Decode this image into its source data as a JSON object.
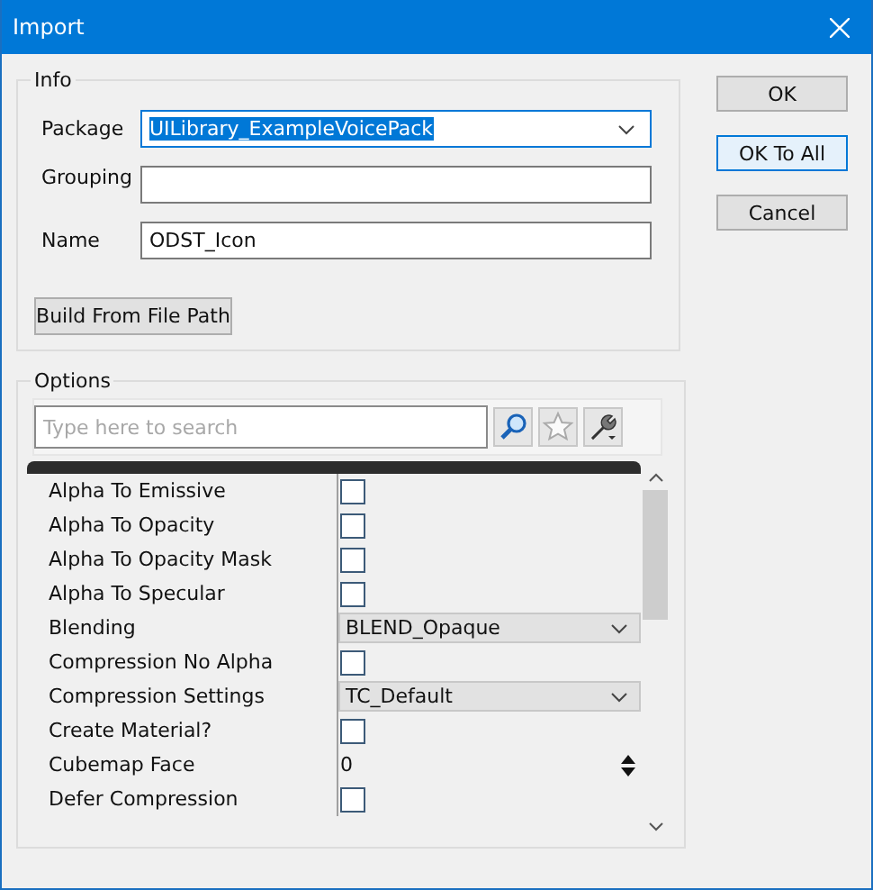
{
  "window": {
    "title": "Import"
  },
  "buttons": [
    {
      "label": "OK",
      "focused": false
    },
    {
      "label": "OK To All",
      "focused": true
    },
    {
      "label": "Cancel",
      "focused": false
    }
  ],
  "info": {
    "title": "Info",
    "fields": [
      {
        "kind": "dropdown",
        "label": "Package",
        "value": "UILibrary_ExampleVoicePack",
        "text_selected": true
      },
      {
        "kind": "text",
        "label": "Grouping"
      },
      {
        "kind": "text",
        "label": "Name",
        "value": "ODST_Icon"
      }
    ],
    "build_button": "Build From File Path"
  },
  "options": {
    "title": "Options",
    "search": {
      "placeholder": "Type here to search"
    },
    "properties": [
      {
        "kind": "checkbox",
        "name": "Alpha To Emissive",
        "checked": false
      },
      {
        "kind": "checkbox",
        "name": "Alpha To Opacity",
        "checked": false
      },
      {
        "kind": "checkbox",
        "name": "Alpha To Opacity Mask",
        "checked": false
      },
      {
        "kind": "checkbox",
        "name": "Alpha To Specular",
        "checked": false
      },
      {
        "kind": "dropdown",
        "name": "Blending",
        "value": "BLEND_Opaque"
      },
      {
        "kind": "checkbox",
        "name": "Compression No Alpha",
        "checked": false
      },
      {
        "kind": "dropdown",
        "name": "Compression Settings",
        "value": "TC_Default"
      },
      {
        "kind": "checkbox",
        "name": "Create Material?",
        "checked": false
      },
      {
        "kind": "number",
        "name": "Cubemap Face",
        "value": "0"
      },
      {
        "kind": "checkbox",
        "name": "Defer Compression",
        "checked": false
      }
    ]
  }
}
